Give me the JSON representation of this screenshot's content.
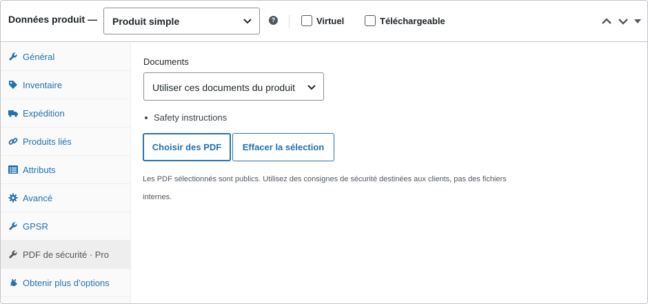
{
  "header": {
    "title": "Données produit —",
    "product_type": "Produit simple",
    "help_icon": "question-icon",
    "virtual_label": "Virtuel",
    "virtual_checked": false,
    "downloadable_label": "Téléchargeable",
    "downloadable_checked": false,
    "move_up_icon": "chevron-up-icon",
    "move_down_icon": "chevron-down-icon",
    "toggle_icon": "triangle-down-icon"
  },
  "sidebar": {
    "items": [
      {
        "label": "Général",
        "icon": "wrench-icon",
        "active": false
      },
      {
        "label": "Inventaire",
        "icon": "tag-icon",
        "active": false
      },
      {
        "label": "Expédition",
        "icon": "truck-icon",
        "active": false
      },
      {
        "label": "Produits liés",
        "icon": "link-icon",
        "active": false
      },
      {
        "label": "Attributs",
        "icon": "list-icon",
        "active": false
      },
      {
        "label": "Avancé",
        "icon": "gear-icon",
        "active": false
      },
      {
        "label": "GPSR",
        "icon": "wrench-icon",
        "active": false
      },
      {
        "label": "PDF de sécurité · Pro",
        "icon": "wrench-icon",
        "active": true
      },
      {
        "label": "Obtenir plus d’options",
        "icon": "plug-icon",
        "active": false
      }
    ]
  },
  "main": {
    "documents_label": "Documents",
    "documents_select": "Utiliser ces documents du produit",
    "documents": [
      "Safety instructions"
    ],
    "choose_button": "Choisir des PDF",
    "clear_button": "Effacer la sélection",
    "help_text": "Les PDF sélectionnés sont publics. Utilisez des consignes de sécurité destinées aux clients, pas des fichiers internes."
  },
  "colors": {
    "accent": "#2271b1",
    "border": "#c3c4c7",
    "sidebar_bg": "#fafafa",
    "active_tab_bg": "#eeeeee"
  }
}
